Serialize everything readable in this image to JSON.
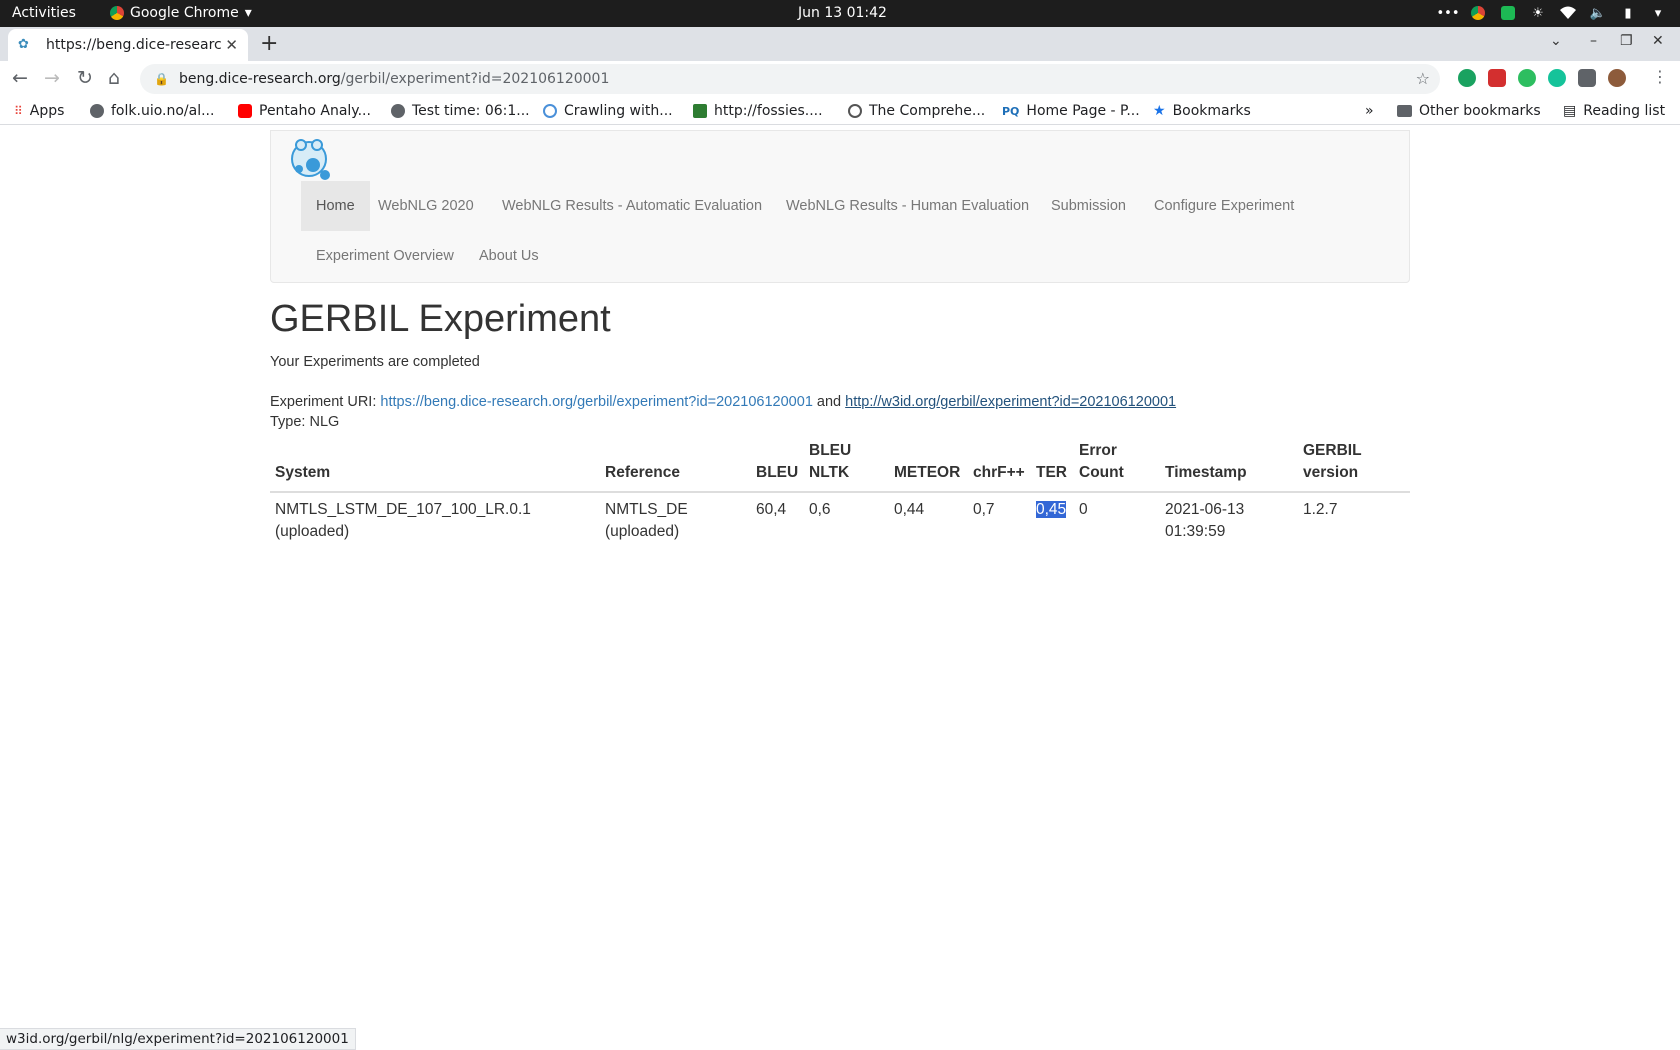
{
  "os_bar": {
    "activities": "Activities",
    "app_name": "Google Chrome",
    "clock": "Jun 13  01:42"
  },
  "browser": {
    "tab_title": "https://beng.dice-researc",
    "url_host": "beng.dice-research.org",
    "url_path": "/gerbil/experiment?id=202106120001",
    "bookmarks": [
      "Apps",
      "folk.uio.no/al...",
      "Pentaho Analy...",
      "Test time: 06:1...",
      "Crawling with...",
      "http://fossies....",
      "The Comprehe...",
      "Home Page - P...",
      "Bookmarks"
    ],
    "other_bookmarks": "Other bookmarks",
    "reading_list": "Reading list",
    "status_url": "w3id.org/gerbil/nlg/experiment?id=202106120001"
  },
  "nav": {
    "items": [
      "Home",
      "WebNLG 2020",
      "WebNLG Results - Automatic Evaluation",
      "WebNLG Results - Human Evaluation",
      "Submission",
      "Configure Experiment",
      "Experiment Overview",
      "About Us"
    ]
  },
  "main": {
    "title": "GERBIL Experiment",
    "status": "Your Experiments are completed",
    "uri_label": "Experiment URI:",
    "uri_link1": "https://beng.dice-research.org/gerbil/experiment?id=202106120001",
    "uri_and": "and",
    "uri_link2": "http://w3id.org/gerbil/experiment?id=202106120001",
    "type": "Type: NLG"
  },
  "table": {
    "headers": {
      "system": "System",
      "reference": "Reference",
      "bleu": "BLEU",
      "bleu_nltk_1": "BLEU",
      "bleu_nltk_2": "NLTK",
      "meteor": "METEOR",
      "chrf": "chrF++",
      "ter": "TER",
      "error_1": "Error",
      "error_2": "Count",
      "timestamp": "Timestamp",
      "version_1": "GERBIL",
      "version_2": "version"
    },
    "row": {
      "system_1": "NMTLS_LSTM_DE_107_100_LR.0.1",
      "system_2": "(uploaded)",
      "reference_1": "NMTLS_DE",
      "reference_2": "(uploaded)",
      "bleu": "60,4",
      "bleu_nltk": "0,6",
      "meteor": "0,44",
      "chrf": "0,7",
      "ter": "0,45",
      "error_count": "0",
      "timestamp_1": "2021-06-13",
      "timestamp_2": "01:39:59",
      "version": "1.2.7"
    }
  }
}
